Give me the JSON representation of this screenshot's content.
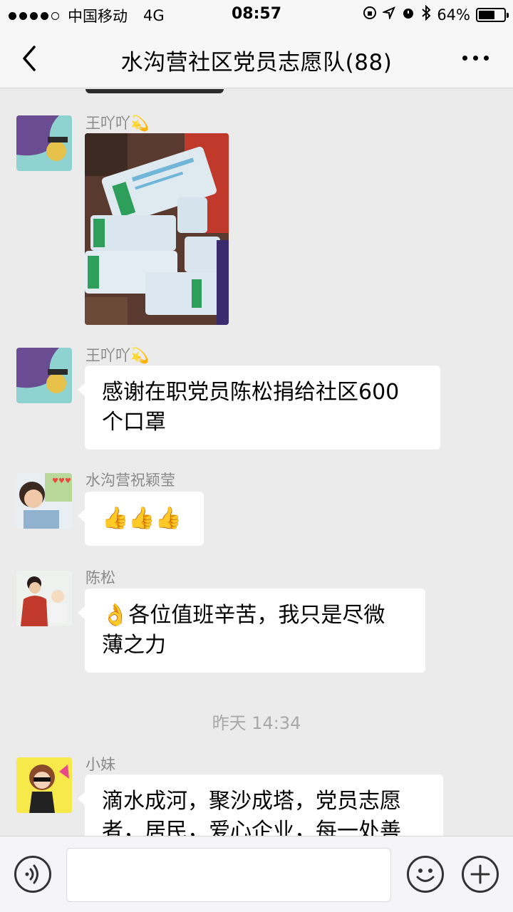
{
  "status_bar": {
    "carrier": "中国移动",
    "network": "4G",
    "time": "08:57",
    "battery_text": "64%",
    "battery_level": 0.64
  },
  "nav": {
    "title": "水沟营社区党员志愿队(88)"
  },
  "messages": [
    {
      "sender": "王吖吖💫",
      "type": "image",
      "image_desc_icon": "photo-masks"
    },
    {
      "sender": "王吖吖💫",
      "type": "text",
      "lines": [
        "感谢在职党员陈松捐给社区600",
        "个口罩"
      ]
    },
    {
      "sender": "水沟营祝颖莹",
      "type": "text",
      "text": "👍👍👍"
    },
    {
      "sender": "陈松",
      "type": "text",
      "lines": [
        "👌各位值班辛苦，我只是尽微",
        "薄之力"
      ]
    }
  ],
  "time_separator": "昨天 14:34",
  "messages_after": [
    {
      "sender": "小妹",
      "type": "text",
      "lines": [
        "滴水成河，聚沙成塔，党员志愿",
        "者，居民，爱心企业，每一处善"
      ]
    }
  ],
  "input": {
    "placeholder": "",
    "value": ""
  },
  "icons": {
    "back": "chevron-left-icon",
    "more": "more-dots-icon",
    "voice": "voice-icon",
    "emoji": "emoji-icon",
    "plus": "plus-icon"
  }
}
